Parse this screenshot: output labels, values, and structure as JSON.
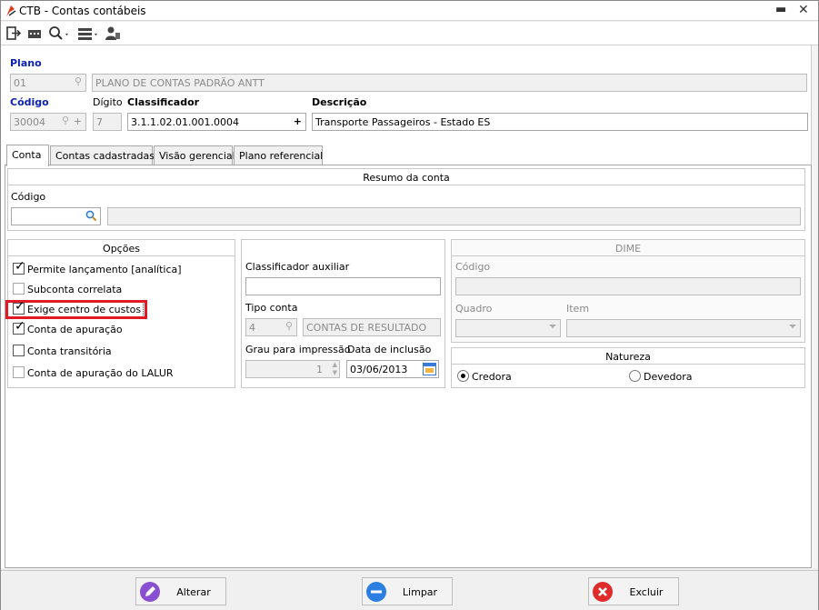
{
  "window": {
    "title": "CTB - Contas contábeis",
    "min_icon": "minimize-icon",
    "close_icon": "close-icon"
  },
  "toolbar": {
    "icons": [
      "exit-icon",
      "record-icon",
      "search-icon",
      "list-icon",
      "user-icon"
    ]
  },
  "plano": {
    "label": "Plano",
    "code": "01",
    "name": "PLANO DE CONTAS PADRÃO ANTT"
  },
  "codigo": {
    "label": "Código",
    "value": "30004"
  },
  "digito": {
    "label": "Dígito",
    "value": "7"
  },
  "classificador": {
    "label": "Classificador",
    "value": "3.1.1.02.01.001.0004",
    "plus": "+"
  },
  "descricao": {
    "label": "Descrição",
    "value": "Transporte Passageiros - Estado ES"
  },
  "tabs": [
    {
      "label": "Conta",
      "active": true
    },
    {
      "label": "Contas cadastradas",
      "active": false
    },
    {
      "label": "Visão gerencial",
      "active": false
    },
    {
      "label": "Plano referencial",
      "active": false
    }
  ],
  "resumo": {
    "title": "Resumo da conta",
    "codigo_label": "Código",
    "codigo_value": "",
    "desc_value": ""
  },
  "opcoes": {
    "title": "Opções",
    "items": [
      {
        "label": "Permite lançamento [analítica]",
        "checked": true
      },
      {
        "label": "Subconta correlata",
        "checked": false
      },
      {
        "label": "Exige centro de custos",
        "checked": true
      },
      {
        "label": "Conta de apuração",
        "checked": true
      },
      {
        "label": "Conta transitória",
        "checked": false
      },
      {
        "label": "Conta de apuração do LALUR",
        "checked": false
      }
    ],
    "highlight_color": "#e01b24"
  },
  "mid": {
    "classificador_aux_label": "Classificador auxiliar",
    "classificador_aux_value": "",
    "tipo_conta_label": "Tipo conta",
    "tipo_conta_code": "4",
    "tipo_conta_name": "CONTAS DE RESULTADO",
    "grau_label": "Grau para impressão",
    "grau_value": "1",
    "data_label": "Data de inclusão",
    "data_value": "03/06/2013"
  },
  "dime": {
    "title": "DIME",
    "codigo_label": "Código",
    "quadro_label": "Quadro",
    "item_label": "Item"
  },
  "natureza": {
    "title": "Natureza",
    "options": [
      {
        "label": "Credora",
        "selected": true
      },
      {
        "label": "Devedora",
        "selected": false
      }
    ]
  },
  "footer": {
    "alterar": "Alterar",
    "limpar": "Limpar",
    "excluir": "Excluir"
  }
}
